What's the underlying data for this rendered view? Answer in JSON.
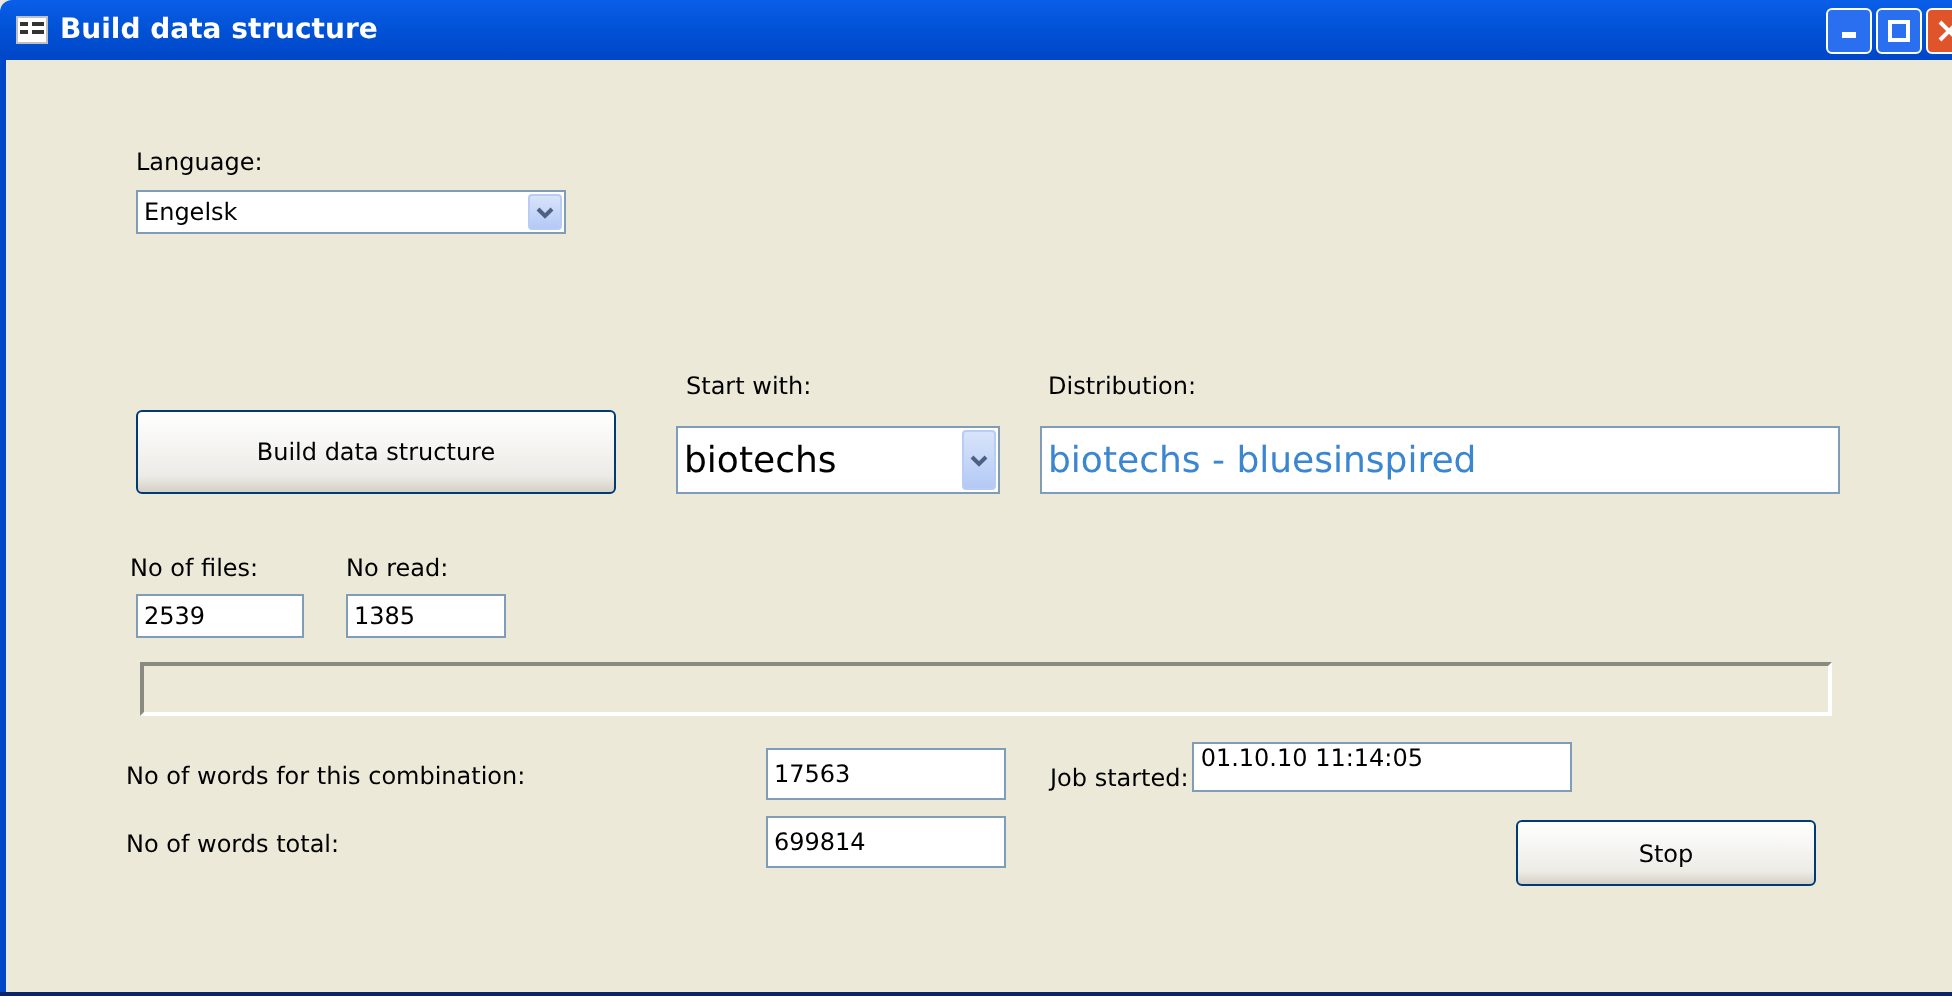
{
  "window": {
    "title": "Build data structure"
  },
  "language": {
    "label": "Language:",
    "value": "Engelsk"
  },
  "build_button": "Build data structure",
  "start_with": {
    "label": "Start with:",
    "value": "biotechs"
  },
  "distribution": {
    "label": "Distribution:",
    "value": "biotechs - bluesinspired"
  },
  "no_of_files": {
    "label": "No of files:",
    "value": "2539"
  },
  "no_read": {
    "label": "No read:",
    "value": "1385"
  },
  "progress": {
    "level": 0
  },
  "words_combination": {
    "label": "No of words for this combination:",
    "value": "17563"
  },
  "job_started": {
    "label": "Job started:",
    "value": "01.10.10 11:14:05"
  },
  "words_total": {
    "label": "No of words total:",
    "value": "699814"
  },
  "stop_button": "Stop"
}
